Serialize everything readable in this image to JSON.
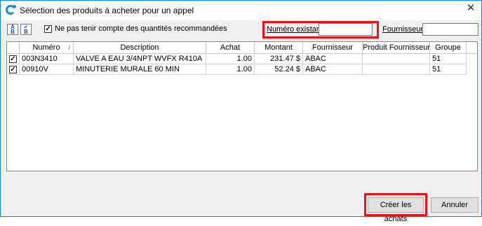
{
  "window": {
    "title": "Sélection des produits à acheter pour un appel",
    "close_glyph": "✕"
  },
  "toolbar": {
    "select_all_icon": "select-all-icon",
    "deselect_all_icon": "deselect-all-icon",
    "ignore_qty_checked": true,
    "ignore_qty_label": "Ne pas tenir compte des quantités recommandées",
    "numero_label": "Numéro existant :",
    "numero_value": "",
    "fournisseur_label": "Fournisseur :",
    "fournisseur_value": ""
  },
  "table": {
    "columns": [
      "Numéro",
      "Description",
      "Achat",
      "Montant",
      "Fournisseur",
      "Produit Fournisseur",
      "Groupe"
    ],
    "sort_indicator": "/",
    "rows": [
      {
        "checked": true,
        "numero": "003N3410",
        "description": "VALVE A EAU 3/4NPT WVFX R410A",
        "achat": "1.00",
        "montant": "231.47 $",
        "fournisseur": "ABAC",
        "produit_fournisseur": "",
        "groupe": "51"
      },
      {
        "checked": true,
        "numero": "00910V",
        "description": "MINUTERIE MURALE 60 MIN",
        "achat": "1.00",
        "montant": "52.24 $",
        "fournisseur": "ABAC",
        "produit_fournisseur": "",
        "groupe": "51"
      }
    ]
  },
  "buttons": {
    "create": "Créer les achats",
    "cancel": "Annuler"
  },
  "colors": {
    "highlight": "#e8141c",
    "accent": "#1c8fd0"
  }
}
